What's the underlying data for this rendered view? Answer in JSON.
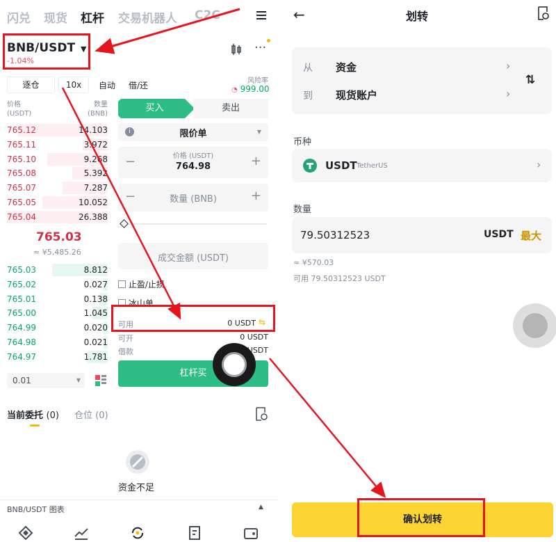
{
  "left": {
    "nav": [
      "闪兑",
      "现货",
      "杠杆",
      "交易机器人",
      "C2C"
    ],
    "nav_active_index": 2,
    "pair": "BNB/USDT",
    "pair_change": "-1.04%",
    "chips": [
      "逐仓",
      "10x",
      "自动",
      "借/还"
    ],
    "risk_label": "风险率",
    "risk_value": "999.00",
    "ob_price_header": "价格",
    "ob_price_unit": "(USDT)",
    "ob_qty_header": "数量",
    "ob_qty_unit": "(BNB)",
    "asks": [
      {
        "price": "765.12",
        "qty": "14.103",
        "depth": 0.9
      },
      {
        "price": "765.11",
        "qty": "3.972",
        "depth": 0.25
      },
      {
        "price": "765.10",
        "qty": "9.268",
        "depth": 0.6
      },
      {
        "price": "765.08",
        "qty": "5.392",
        "depth": 0.35
      },
      {
        "price": "765.07",
        "qty": "7.287",
        "depth": 0.45
      },
      {
        "price": "765.05",
        "qty": "10.052",
        "depth": 0.65
      },
      {
        "price": "765.04",
        "qty": "26.388",
        "depth": 1.0
      }
    ],
    "last_price": "765.03",
    "last_price_fiat": "≈ ¥5,485.26",
    "bids": [
      {
        "price": "765.03",
        "qty": "8.812",
        "depth": 0.55
      },
      {
        "price": "765.02",
        "qty": "0.027",
        "depth": 0.05
      },
      {
        "price": "765.01",
        "qty": "0.138",
        "depth": 0.08
      },
      {
        "price": "765.00",
        "qty": "1.045",
        "depth": 0.15
      },
      {
        "price": "764.99",
        "qty": "0.020",
        "depth": 0.04
      },
      {
        "price": "764.98",
        "qty": "0.021",
        "depth": 0.04
      },
      {
        "price": "764.97",
        "qty": "1.781",
        "depth": 0.2
      }
    ],
    "precision": "0.01",
    "buy_tab": "买入",
    "sell_tab": "卖出",
    "order_type": "限价单",
    "price_label": "价格 (USDT)",
    "price_value": "764.98",
    "qty_placeholder": "数量 (BNB)",
    "amount_placeholder": "成交金额 (USDT)",
    "tp_sl": "止盈/止损",
    "iceberg": "冰山单",
    "available_label": "可用",
    "available_value": "0 USDT",
    "open_label": "可开",
    "open_value": "0 USDT",
    "borrow_label": "借款",
    "borrow_value": "USDT",
    "margin_buy": "杠杆买",
    "tab_orders": "当前委托",
    "tab_orders_count": "(0)",
    "tab_positions": "仓位",
    "tab_positions_count": "(0)",
    "empty_text": "资金不足",
    "chart_label": "BNB/USDT 图表"
  },
  "right": {
    "title": "划转",
    "from_label": "从",
    "from_value": "资金",
    "to_label": "到",
    "to_value": "现货账户",
    "coin_section": "币种",
    "coin": "USDT",
    "coin_full": "TetherUS",
    "amount_section": "数量",
    "amount": "79.50312523",
    "amount_unit": "USDT",
    "max_label": "最大",
    "amount_fiat": "≈ ¥570.03",
    "available_text": "可用 79.50312523 USDT",
    "confirm": "确认划转"
  },
  "colors": {
    "accent_yellow": "#fcd535",
    "green": "#2ebd85",
    "red": "#f6465d",
    "annotation_red": "#e5141e"
  }
}
